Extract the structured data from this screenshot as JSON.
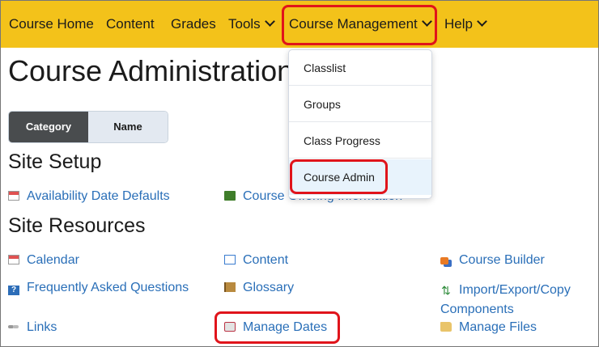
{
  "nav": {
    "items": [
      {
        "label": "Course Home"
      },
      {
        "label": "Content"
      },
      {
        "label": "Grades"
      },
      {
        "label": "Tools"
      },
      {
        "label": "Course Management"
      },
      {
        "label": "Help"
      }
    ]
  },
  "page": {
    "title": "Course Administration"
  },
  "toggle": {
    "category": "Category",
    "name": "Name",
    "selected": "Category"
  },
  "dropdown": {
    "items": [
      {
        "label": "Classlist"
      },
      {
        "label": "Groups"
      },
      {
        "label": "Class Progress"
      },
      {
        "label": "Course Admin"
      }
    ],
    "selected": "Course Admin"
  },
  "sections": {
    "site_setup": {
      "heading": "Site Setup",
      "links": [
        {
          "label": "Availability Date Defaults",
          "icon": "calendar-icon"
        },
        {
          "label": "Course Offering Information",
          "icon": "green-book-icon"
        }
      ]
    },
    "site_resources": {
      "heading": "Site Resources",
      "links": [
        {
          "label": "Calendar",
          "icon": "calendar-icon"
        },
        {
          "label": "Content",
          "icon": "open-book-icon"
        },
        {
          "label": "Course Builder",
          "icon": "builder-icon"
        },
        {
          "label": "Frequently Asked Questions",
          "icon": "faq-icon"
        },
        {
          "label": "Glossary",
          "icon": "brown-book-icon"
        },
        {
          "label": "Import/Export/Copy",
          "label2": "Components",
          "icon": "import-export-icon"
        },
        {
          "label": "Links",
          "icon": "link-icon"
        },
        {
          "label": "Manage Dates",
          "icon": "gear-calendar-icon"
        },
        {
          "label": "Manage Files",
          "icon": "folder-icon"
        }
      ]
    }
  },
  "colors": {
    "navbar": "#f3c21a",
    "link": "#2a6fb8",
    "highlight": "#e0141b"
  }
}
